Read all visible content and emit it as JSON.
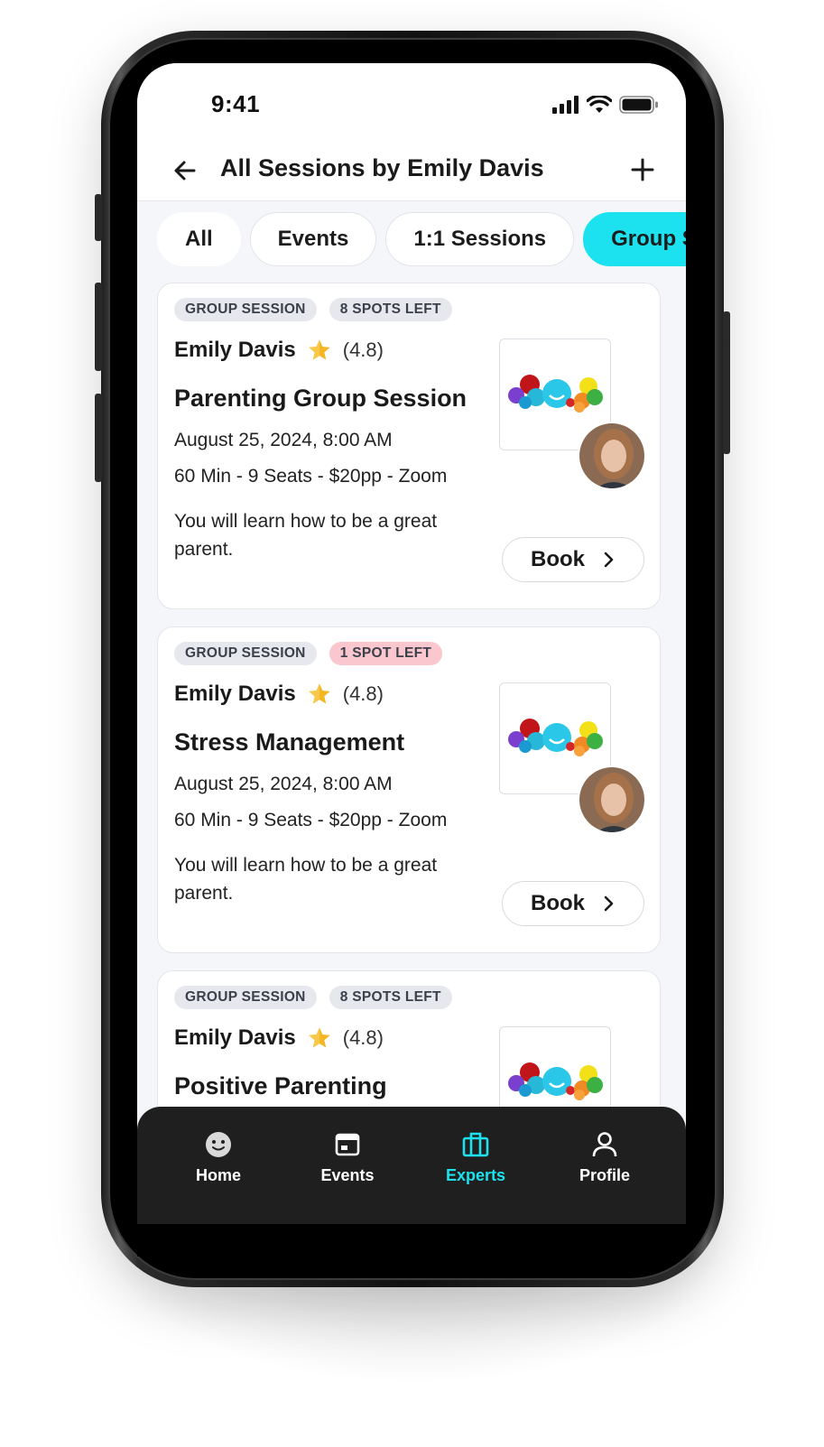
{
  "status_bar": {
    "time": "9:41"
  },
  "header": {
    "title": "All Sessions by Emily Davis"
  },
  "filters": [
    "All",
    "Events",
    "1:1 Sessions",
    "Group Sessions"
  ],
  "active_filter": "Group Sessions",
  "sessions": [
    {
      "type_tag": "GROUP SESSION",
      "spots_tag": "8 SPOTS LEFT",
      "host": "Emily Davis",
      "rating": "(4.8)",
      "title": "Parenting Group Session",
      "date": "August 25, 2024, 8:00 AM",
      "meta": "60 Min - 9 Seats - $20pp - Zoom",
      "description": "You will learn how to be a great parent.",
      "book_label": "Book"
    },
    {
      "type_tag": "GROUP SESSION",
      "spots_tag": "1 SPOT LEFT",
      "host": "Emily Davis",
      "rating": "(4.8)",
      "title": "Stress Management",
      "date": "August 25, 2024, 8:00 AM",
      "meta": "60 Min - 9 Seats - $20pp - Zoom",
      "description": "You will learn how to be a great parent.",
      "book_label": "Book"
    },
    {
      "type_tag": "GROUP SESSION",
      "spots_tag": "8 SPOTS LEFT",
      "host": "Emily Davis",
      "rating": "(4.8)",
      "title": "Positive Parenting",
      "date": "",
      "meta": "",
      "description": "",
      "book_label": ""
    }
  ],
  "tabbar": {
    "items": [
      {
        "label": "Home",
        "icon": "smiley-face-icon"
      },
      {
        "label": "Events",
        "icon": "calendar-icon"
      },
      {
        "label": "Experts",
        "icon": "briefcase-icon"
      },
      {
        "label": "Profile",
        "icon": "person-icon"
      }
    ],
    "active": "Experts"
  },
  "colors": {
    "accent": "#1ce1ee",
    "urgent_tag": "#fbc7cf",
    "tag": "#e6e8ee",
    "star": "#f5b623",
    "tabbar_bg": "#1f1f1f"
  }
}
